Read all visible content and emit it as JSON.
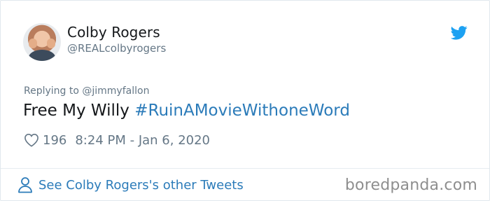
{
  "author": {
    "name": "Colby Rogers",
    "handle": "@REALcolbyrogers"
  },
  "reply": {
    "label": "Replying to @jimmyfallon"
  },
  "tweet": {
    "text": "Free My Willy ",
    "hashtag": "#RuinAMovieWithoneWord"
  },
  "meta": {
    "likes": "196",
    "timestamp": "8:24 PM - Jan 6, 2020"
  },
  "footer": {
    "see_more": "See Colby Rogers's other Tweets",
    "watermark": "boredpanda.com"
  },
  "icons": {
    "brand": "twitter-bird-icon",
    "like": "heart-icon",
    "profile": "person-icon"
  },
  "colors": {
    "link": "#2b7bb9",
    "twitter_blue": "#1da1f2",
    "muted": "#657786",
    "text": "#14171a"
  }
}
